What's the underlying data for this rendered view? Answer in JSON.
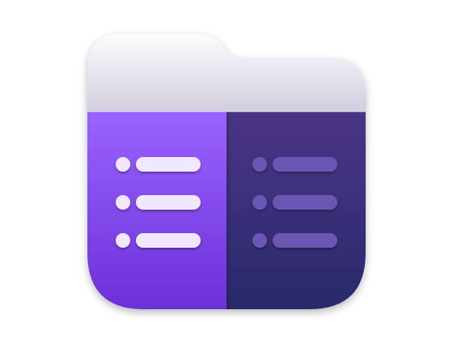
{
  "icon": {
    "name": "dual-pane-folder-app-icon",
    "colors": {
      "folder_tab_top": "#ffffff",
      "folder_tab_bottom": "#cfc9dd",
      "left_pane_top": "#9a63ff",
      "left_pane_bottom": "#6a2fd6",
      "right_pane_top": "#4c3486",
      "right_pane_bottom": "#272a6b",
      "left_list_items": "#f1e8ff",
      "right_list_items": "#6c57b4"
    },
    "left_pane_rows": 3,
    "right_pane_rows": 3
  }
}
